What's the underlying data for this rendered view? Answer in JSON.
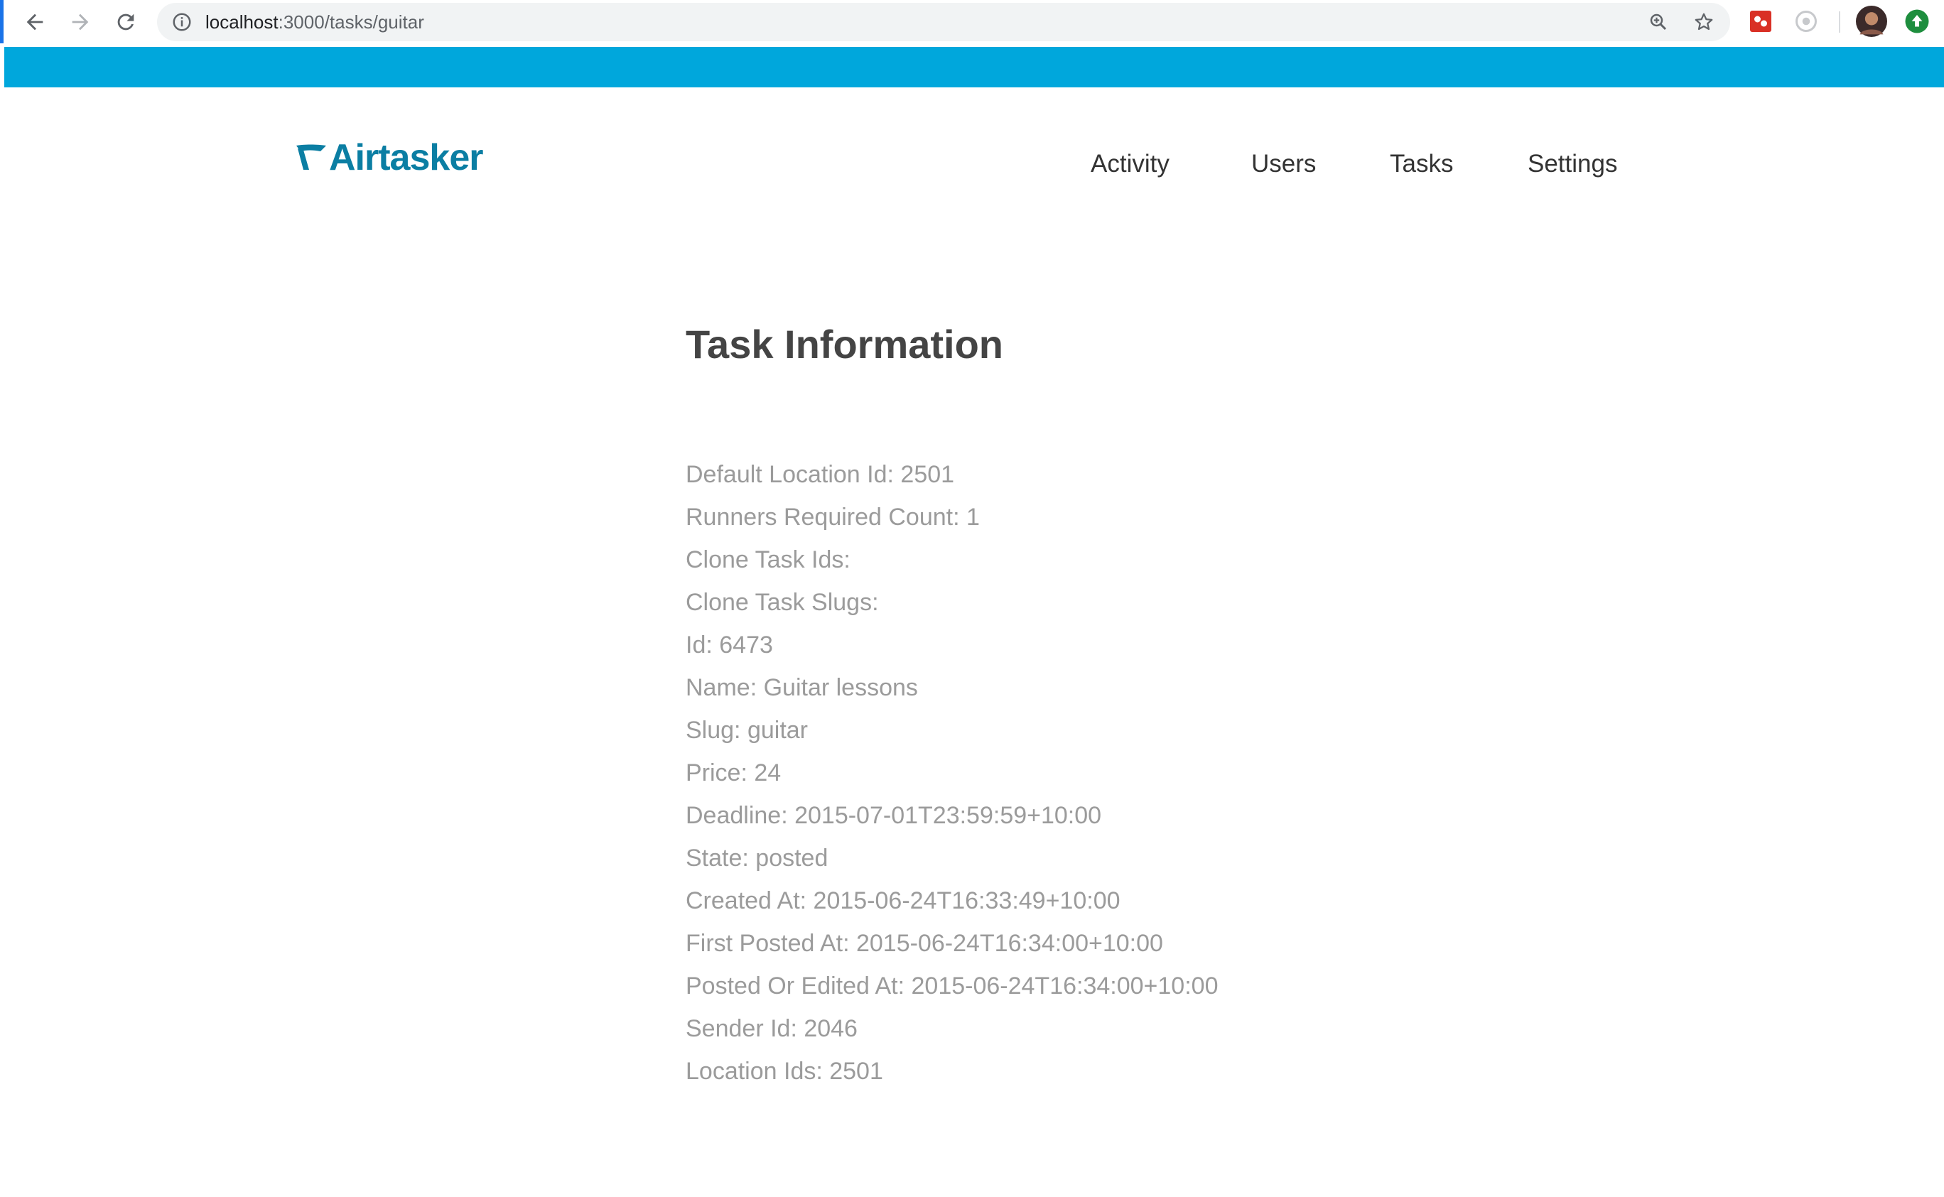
{
  "browser": {
    "url_host": "localhost",
    "url_path": ":3000/tasks/guitar"
  },
  "header": {
    "logo_text": "Airtasker",
    "nav": [
      {
        "label": "Activity"
      },
      {
        "label": "Users"
      },
      {
        "label": "Tasks"
      },
      {
        "label": "Settings"
      }
    ]
  },
  "main": {
    "title": "Task Information",
    "fields": [
      {
        "text": "Default Location Id: 2501"
      },
      {
        "text": "Runners Required Count: 1"
      },
      {
        "text": "Clone Task Ids:"
      },
      {
        "text": "Clone Task Slugs:"
      },
      {
        "text": "Id: 6473"
      },
      {
        "text": "Name: Guitar lessons"
      },
      {
        "text": "Slug: guitar"
      },
      {
        "text": "Price: 24"
      },
      {
        "text": "Deadline: 2015-07-01T23:59:59+10:00"
      },
      {
        "text": "State: posted"
      },
      {
        "text": "Created At: 2015-06-24T16:33:49+10:00"
      },
      {
        "text": "First Posted At: 2015-06-24T16:34:00+10:00"
      },
      {
        "text": "Posted Or Edited At: 2015-06-24T16:34:00+10:00"
      },
      {
        "text": "Sender Id: 2046"
      },
      {
        "text": "Location Ids: 2501"
      }
    ]
  },
  "colors": {
    "brand_blue": "#00a7dc",
    "logo_blue": "#0b7ea3",
    "field_text": "#9b9b9b",
    "title_text": "#444444"
  },
  "icons": [
    "back-arrow-icon",
    "forward-arrow-icon",
    "reload-icon",
    "info-icon",
    "zoom-icon",
    "star-icon",
    "extension-icon",
    "profile-avatar",
    "update-icon"
  ]
}
